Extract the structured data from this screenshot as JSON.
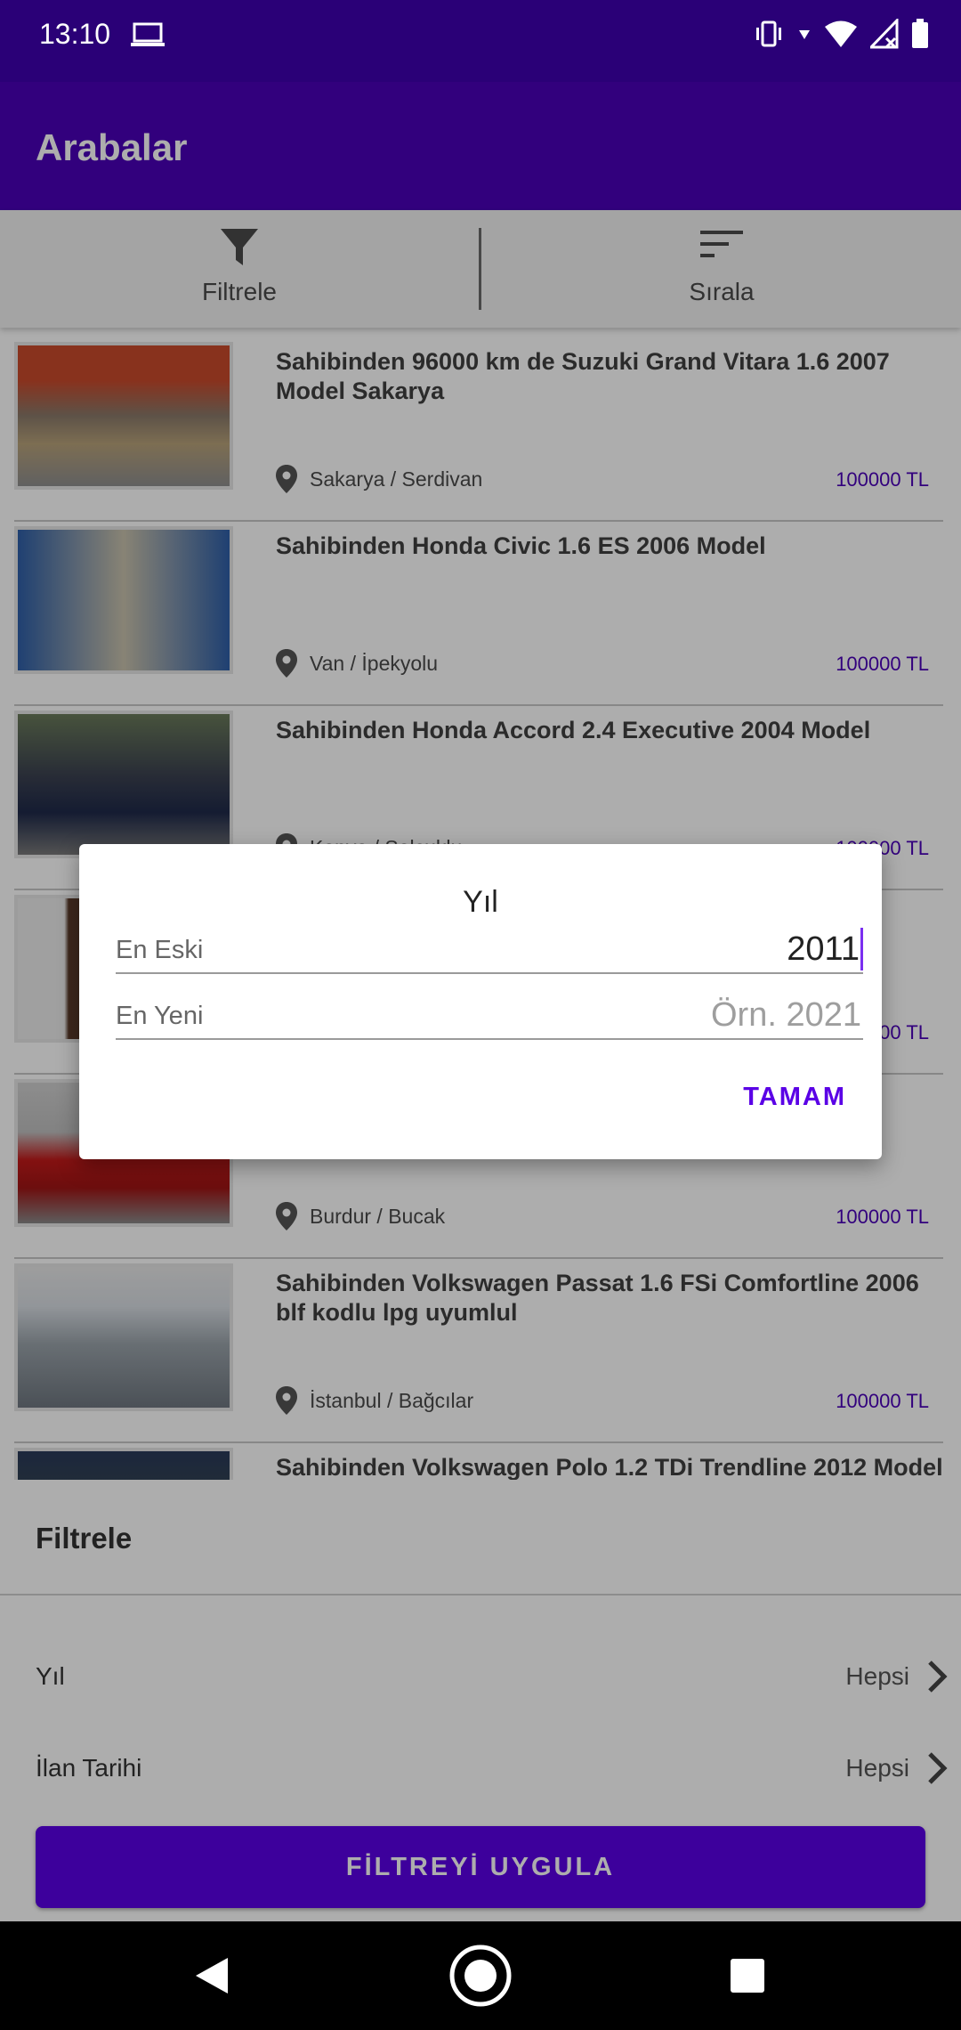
{
  "status_bar": {
    "time": "13:10"
  },
  "app_bar": {
    "title": "Arabalar"
  },
  "toolbar": {
    "filter_label": "Filtrele",
    "sort_label": "Sırala"
  },
  "listings": [
    {
      "title": "Sahibinden 96000 km de Suzuki Grand Vitara 1.6 2007 Model Sakarya",
      "location": "Sakarya / Serdivan",
      "price": "100000 TL"
    },
    {
      "title": "Sahibinden Honda Civic 1.6 ES 2006 Model",
      "location": "Van / İpekyolu",
      "price": "100000 TL"
    },
    {
      "title": "Sahibinden Honda Accord 2.4 Executive 2004 Model",
      "location": "Konya / Selçuklu",
      "price": "100000 TL"
    },
    {
      "title": "",
      "location": "",
      "price": "100000 TL"
    },
    {
      "title": "",
      "location": "Burdur / Bucak",
      "price": "100000 TL"
    },
    {
      "title": "Sahibinden Volkswagen Passat 1.6 FSi Comfortline 2006 blf kodlu lpg uyumlul",
      "location": "İstanbul / Bağcılar",
      "price": "100000 TL"
    },
    {
      "title": "Sahibinden Volkswagen Polo 1.2 TDi Trendline 2012 Model",
      "location": "",
      "price": ""
    }
  ],
  "filter_sheet": {
    "title": "Filtrele",
    "rows": [
      {
        "label": "Yıl",
        "value": "Hepsi"
      },
      {
        "label": "İlan Tarihi",
        "value": "Hepsi"
      }
    ],
    "apply_label": "FİLTREYİ UYGULA"
  },
  "dialog": {
    "title": "Yıl",
    "oldest_label": "En Eski",
    "oldest_value": "2011",
    "newest_label": "En Yeni",
    "newest_placeholder": "Örn. 2021",
    "ok_label": "TAMAM"
  },
  "colors": {
    "status_bar": "#2a0077",
    "app_bar": "#4a00b8",
    "accent": "#5a00e6"
  }
}
